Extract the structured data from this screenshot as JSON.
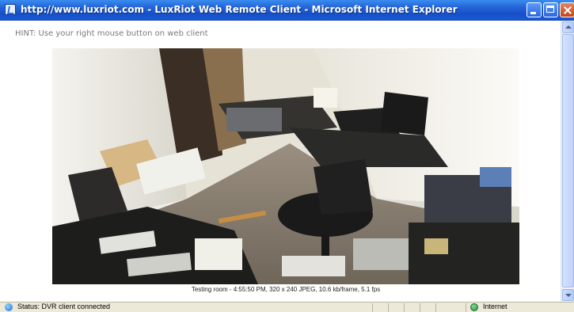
{
  "window": {
    "title": "http://www.luxriot.com - LuxRiot Web Remote Client - Microsoft Internet Explorer",
    "icon": "ie-page-icon",
    "buttons": [
      "minimize",
      "maximize",
      "close"
    ]
  },
  "content": {
    "hint": "HINT: Use your right mouse button on web client",
    "camera": {
      "caption": "Testing room - 4:55:50 PM, 320 x 240 JPEG, 10.6 kb/frame, 5.1 fps"
    }
  },
  "statusbar": {
    "status_text": "Status: DVR client connected",
    "zone_text": "Internet"
  },
  "colors": {
    "titlebar": "#2466d8",
    "statusbar": "#ece9d8",
    "hint_text": "#7a7a7a"
  }
}
